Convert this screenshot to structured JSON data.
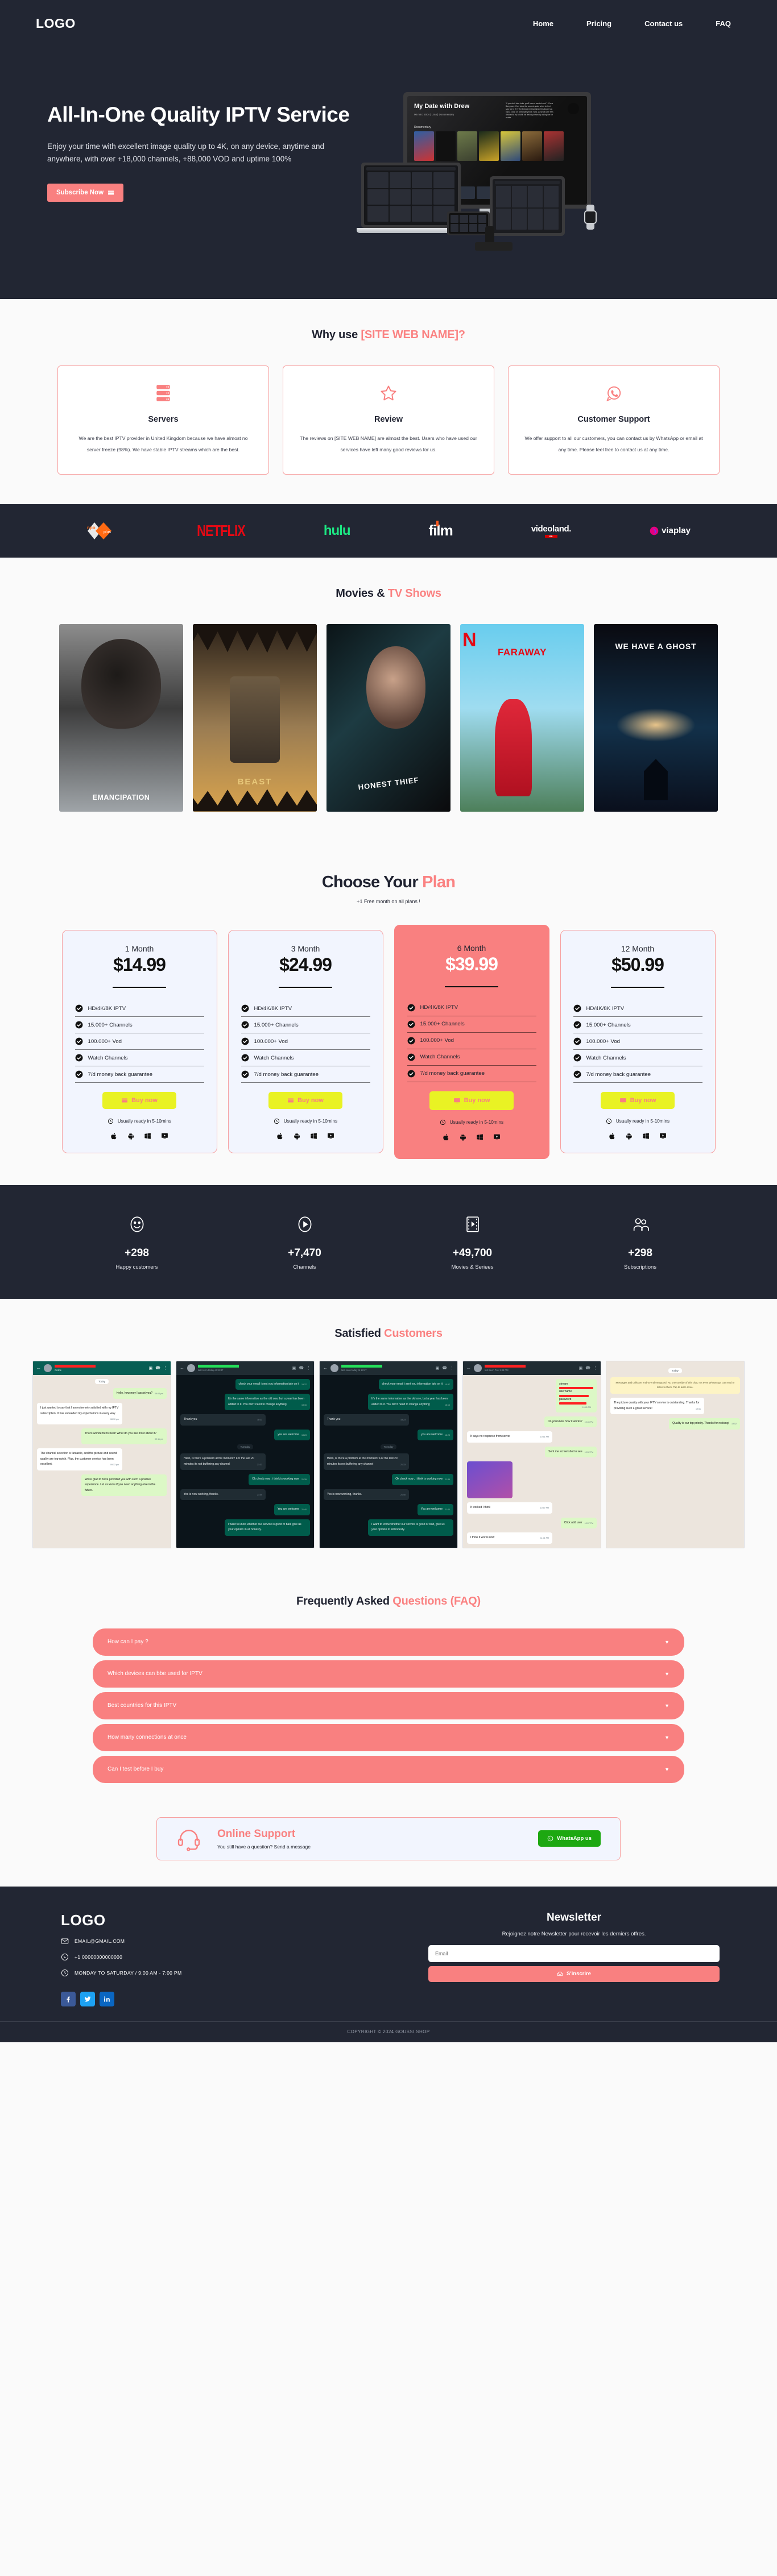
{
  "brand_colors": {
    "accent": "#f98080",
    "dark": "#222633",
    "yellow": "#e9f224",
    "whatsapp_green": "#1da811"
  },
  "header": {
    "logo": "LOGO",
    "nav": [
      {
        "label": "Home"
      },
      {
        "label": "Pricing"
      },
      {
        "label": "Contact us"
      },
      {
        "label": "FAQ"
      }
    ]
  },
  "hero": {
    "title": "All-In-One Quality IPTV Service",
    "subtitle": "Enjoy your time with excellent image quality up to 4K, on any device, anytime and anywhere, with over +18,000 channels, +88,000 VOD and uptime 100%",
    "cta": "Subscribe Now",
    "device_mock": {
      "title": "My Date with Drew",
      "meta": "90 min  |  2004  |  USA  |  Documentary",
      "rating": "6.5 IMDb",
      "likes": "96% users",
      "genre_row_label": "Documentary",
      "description": "\"If you don't take risks, you'll have a wasted soul.\" - Drew Barrymore. Ever since the second grade when he first saw her in E.T. The Extraterrestrial, Brian Herzlinger has had a crush on Drew Barrymore. Now, 20 years later he's decided to try to fulfill his lifelong dream by asking her for a date."
    }
  },
  "why": {
    "title_plain": "Why use ",
    "title_accent": "[SITE WEB NAME]?",
    "cards": [
      {
        "icon": "server-icon",
        "title": "Servers",
        "text": "We are the best IPTV provider in United Kingdom because we have almost no server freeze (98%). We have stable IPTV streams which are the best."
      },
      {
        "icon": "star-icon",
        "title": "Review",
        "text": "The reviews on [SITE WEB NAME] are almost the best. Users who have used our services have left many good reviews for us."
      },
      {
        "icon": "whatsapp-icon",
        "title": "Customer Support",
        "text": "We offer support to all our customers, you can contact us by WhatsApp or email at any time. Please feel free to contact us at any time."
      }
    ]
  },
  "brands": [
    {
      "name": "npo plus",
      "id": "npo"
    },
    {
      "name": "NETFLIX",
      "id": "netflix"
    },
    {
      "name": "hulu",
      "id": "hulu"
    },
    {
      "name": "film",
      "id": "film"
    },
    {
      "name": "videoland.",
      "id": "videoland",
      "sub": "RTL"
    },
    {
      "name": "viaplay",
      "id": "viaplay"
    }
  ],
  "movies": {
    "title_plain": "Movies & ",
    "title_accent": "TV Shows",
    "posters": [
      {
        "title": "EMANCIPATION"
      },
      {
        "title": "BEAST"
      },
      {
        "title": "HONEST THIEF"
      },
      {
        "title": "FARAWAY"
      },
      {
        "title": "WE HAVE A GHOST"
      }
    ]
  },
  "pricing": {
    "title_plain": "Choose Your ",
    "title_accent": "Plan",
    "note": "+1 Free month on all plans !",
    "features": [
      "HD/4K/8K IPTV",
      "15.000+ Channels",
      "100.000+ Vod",
      "Watch Channels",
      "7/d money back guarantee"
    ],
    "buy_label": "Buy now",
    "ready_label": "Usually ready in 5-10mins",
    "os_icons": [
      "apple-icon",
      "android-icon",
      "windows-icon",
      "smart-tv-icon"
    ],
    "plans": [
      {
        "name": "1 Month",
        "price": "$14.99",
        "featured": false
      },
      {
        "name": "3 Month",
        "price": "$24.99",
        "featured": false
      },
      {
        "name": "6 Month",
        "price": "$39.99",
        "featured": true
      },
      {
        "name": "12 Month",
        "price": "$50.99",
        "featured": false
      }
    ]
  },
  "stats": [
    {
      "icon": "smiley-icon",
      "value": "+298",
      "label": "Happy customers"
    },
    {
      "icon": "play-icon",
      "value": "+7,470",
      "label": "Channels"
    },
    {
      "icon": "film-icon",
      "value": "+49,700",
      "label": "Movies & Seriees"
    },
    {
      "icon": "users-icon",
      "value": "+298",
      "label": "Subscriptions"
    }
  ],
  "testimonials": {
    "title_plain": "Satisfied ",
    "title_accent": "Customers",
    "chats": [
      {
        "status": "Online",
        "theme": "light",
        "day": "Today",
        "messages": [
          {
            "side": "out",
            "text": "Hello, how may I assist you?",
            "time": "09:04 pm"
          },
          {
            "side": "in",
            "text": "I just wanted to say that I am extremely satisfied with my IPTV subscription. It has exceeded my expectations in every way.",
            "time": "08:10 pm"
          },
          {
            "side": "out",
            "text": "That's wonderful to hear! What do you like most about it?",
            "time": "09:11 pm"
          },
          {
            "side": "in",
            "text": "The channel selection is fantastic, and the picture and sound quality are top-notch. Plus, the customer service has been excellent.",
            "time": "09:13 pm"
          },
          {
            "side": "out",
            "text": "We're glad to have provided you with such a positive experience. Let us know if you need anything else in the future.",
            "time": ""
          }
        ]
      },
      {
        "status": "last seen today at 18:47",
        "theme": "dark",
        "day": "Tuesday",
        "messages": [
          {
            "side": "out",
            "text": "check your email i sent you information iptv on it",
            "time": "15:37"
          },
          {
            "side": "out",
            "text": "It's the same information as the old one, but a year has been added to it. You don't need to change anything",
            "time": "18:16"
          },
          {
            "side": "in",
            "text": "Thank you",
            "time": "18:23"
          },
          {
            "side": "out",
            "text": "you are welcome",
            "time": "18:23"
          },
          {
            "side": "in",
            "text": "Hello, is there a problem at the moment? For the last 20 minutes its not buffering any channel",
            "time": "21:33"
          },
          {
            "side": "out",
            "text": "Ok check now , i think is working now",
            "time": "21:39"
          },
          {
            "side": "in",
            "text": "Yes is now working, thanks.",
            "time": "21:40"
          },
          {
            "side": "out",
            "text": "You are welcome",
            "time": "21:40"
          },
          {
            "side": "out",
            "text": "I want to know whether our service is good or bad, give us your opinion in all honesty.",
            "time": "11:08"
          }
        ]
      },
      {
        "status": "last seen today at 18:47",
        "theme": "dark",
        "day": "Tuesday",
        "messages": [
          {
            "side": "out",
            "text": "check your email i sent you information iptv on it",
            "time": "15:37"
          },
          {
            "side": "out",
            "text": "It's the same information as the old one, but a year has been added to it. You don't need to change anything",
            "time": "18:16"
          },
          {
            "side": "in",
            "text": "Thank you",
            "time": "18:23"
          },
          {
            "side": "out",
            "text": "you are welcome",
            "time": "18:23"
          },
          {
            "side": "in",
            "text": "Hello, is there a problem at the moment? For the last 20 minutes its not buffering any channel",
            "time": "21:33"
          },
          {
            "side": "out",
            "text": "Ok check now , i think is working now",
            "time": "21:39"
          },
          {
            "side": "in",
            "text": "Yes is now working, thanks.",
            "time": "21:40"
          },
          {
            "side": "out",
            "text": "You are welcome",
            "time": "21:40"
          },
          {
            "side": "out",
            "text": "I want to know whether our service is good or bad, give us your opinion in all honesty.",
            "time": "11:08"
          }
        ]
      },
      {
        "status": "last seen Tue 1:46 PM",
        "theme": "light",
        "day": "",
        "messages": [
          {
            "side": "out",
            "text": "xtream   http://…\nusername  ……\npassword  ……",
            "time": "10:45 PM"
          },
          {
            "side": "out",
            "text": "Do you know how it works?",
            "time": "10:46 PM"
          },
          {
            "side": "in",
            "text": "It says no response from server",
            "time": "10:51 PM"
          },
          {
            "side": "out",
            "text": "Sent me screenshot to see",
            "time": "10:52 PM"
          },
          {
            "side": "in",
            "text": "It worked I think",
            "time": "10:57 PM"
          },
          {
            "side": "out",
            "text": "Click add user",
            "time": "10:57 PM"
          },
          {
            "side": "in",
            "text": "I think it works now",
            "time": "11:01 PM"
          }
        ]
      },
      {
        "status": "",
        "theme": "light",
        "day": "Today",
        "encryption_note": "Messages and calls are end-to-end encrypted. No one outside of this chat, not even WhatsApp, can read or listen to them. Tap to learn more.",
        "messages": [
          {
            "side": "in",
            "text": "The picture quality with your IPTV service is outstanding. Thanks for providing such a great service!",
            "time": "19:51"
          },
          {
            "side": "out",
            "text": "Quality is our top priority. Thanks for noticing!",
            "time": "19:52"
          }
        ]
      }
    ]
  },
  "faq": {
    "title_plain": "Frequently Asked ",
    "title_accent": "Questions (FAQ)",
    "items": [
      "How can I pay ?",
      "Which devices can bbe used for IPTV",
      "Best countries for this IPTV",
      "How many connections at once",
      "Can I test before I buy"
    ]
  },
  "support": {
    "icon": "headset-icon",
    "title": "Online Support",
    "text": "You still have a question? Send a message",
    "button": "WhatsApp us"
  },
  "footer": {
    "logo": "LOGO",
    "contacts": [
      {
        "icon": "email-icon",
        "text": "EMAIL@GMAIL.COM"
      },
      {
        "icon": "whatsapp-icon",
        "text": "+1 00000000000000"
      },
      {
        "icon": "clock-icon",
        "text": "MONDAY TO SATURDAY / 9:00 AM - 7:00 PM"
      }
    ],
    "socials": [
      "facebook-icon",
      "twitter-icon",
      "linkedin-icon"
    ],
    "newsletter": {
      "title": "Newsletter",
      "subtitle": "Rejoignez notre Newsletter pour recevoir les derniers offres.",
      "placeholder": "Email",
      "value": "",
      "button": "S'inscrire"
    },
    "copyright": "COPYRIGHT © 2024 GOUSSI.SHOP"
  }
}
